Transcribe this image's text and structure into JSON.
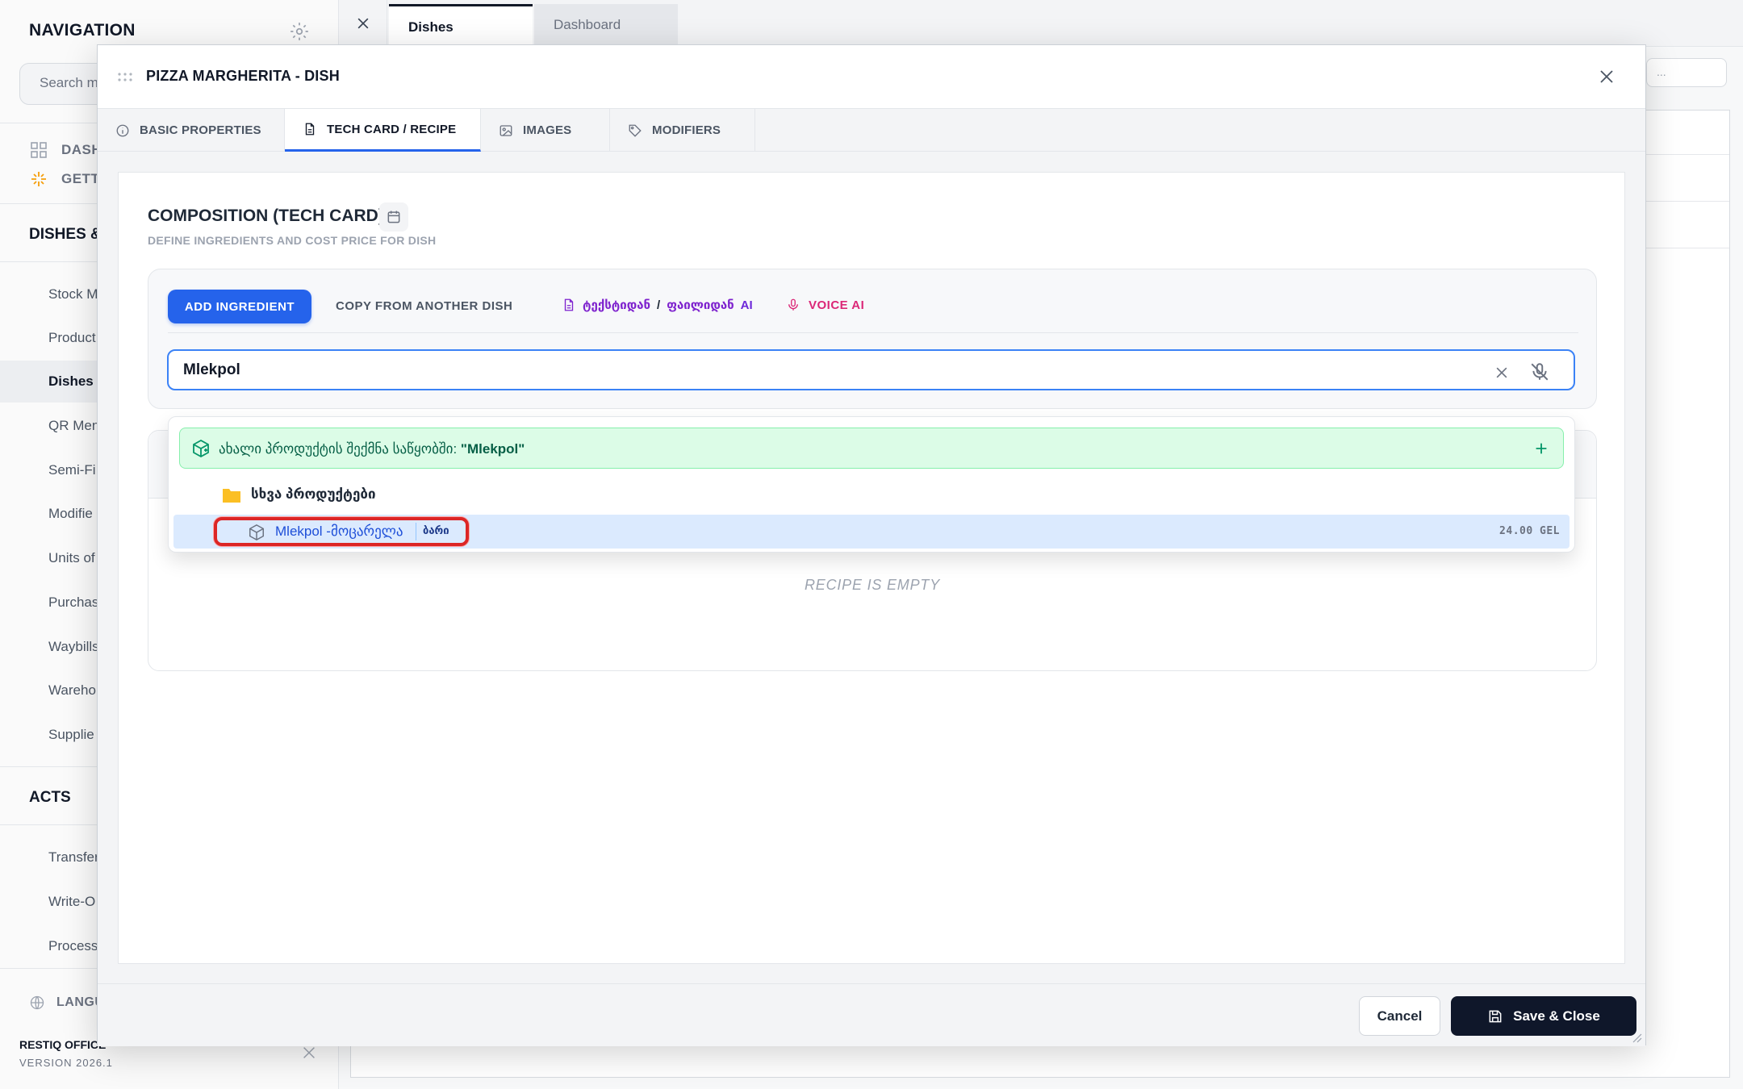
{
  "sidebar": {
    "title": "NAVIGATION",
    "search_placeholder": "Search m",
    "top_items": [
      {
        "label": "DASH",
        "icon": "grid-icon"
      },
      {
        "label": "GETTI",
        "icon": "sparkle-icon"
      }
    ],
    "section_dishes": "DISHES &",
    "items": [
      "Stock M",
      "Product",
      "Dishes",
      "QR Men",
      "Semi-Fi",
      "Modifie",
      "Units of",
      "Purchas",
      "Waybills",
      "Wareho",
      "Supplie"
    ],
    "section_acts": "ACTS",
    "act_items": [
      "Transfer",
      "Write-O",
      "Processi"
    ],
    "language_label": "LANGU",
    "brand": "RESTIQ OFFICE",
    "version": "VERSION 2026.1"
  },
  "topbar": {
    "tabs": [
      {
        "label": "Dishes",
        "active": true
      },
      {
        "label": "Dashboard",
        "active": false
      }
    ]
  },
  "background": {
    "search_placeholder": "..."
  },
  "modal": {
    "title": "PIZZA MARGHERITA - DISH",
    "tabs": [
      {
        "label": "BASIC PROPERTIES",
        "icon": "info-icon"
      },
      {
        "label": "TECH CARD / RECIPE",
        "icon": "document-icon",
        "active": true
      },
      {
        "label": "IMAGES",
        "icon": "image-icon"
      },
      {
        "label": "MODIFIERS",
        "icon": "tag-icon"
      }
    ],
    "composition": {
      "title": "COMPOSITION (TECH CARD)",
      "subtitle": "DEFINE INGREDIENTS AND COST PRICE FOR DISH"
    },
    "toolbar": {
      "add_ingredient": "ADD INGREDIENT",
      "copy_from": "COPY FROM ANOTHER DISH",
      "ai_text_part": "ტექსტიდან",
      "ai_slash": "/",
      "ai_file_part": "ფაილიდან",
      "ai_label": "AI",
      "voice_ai": "VOICE AI"
    },
    "search": {
      "value": "Mlekpol"
    },
    "dropdown": {
      "create_prefix": "ახალი პროდუქტის შექმნა საწყობში:",
      "create_query": "\"Mlekpol\"",
      "group_label": "სხვა პროდუქტები",
      "item": {
        "name": "Mlekpol -მოცარელა",
        "badge": "ბარი",
        "price": "24.00 GEL"
      }
    },
    "recipe_empty": "RECIPE IS EMPTY",
    "footer": {
      "cancel": "Cancel",
      "save": "Save & Close"
    }
  },
  "colors": {
    "primary": "#2563eb",
    "dark": "#0f172a",
    "success_bg": "#dcfce7",
    "highlight": "#dc2626",
    "ai_purple": "#7e22ce",
    "voice_pink": "#db2777"
  }
}
